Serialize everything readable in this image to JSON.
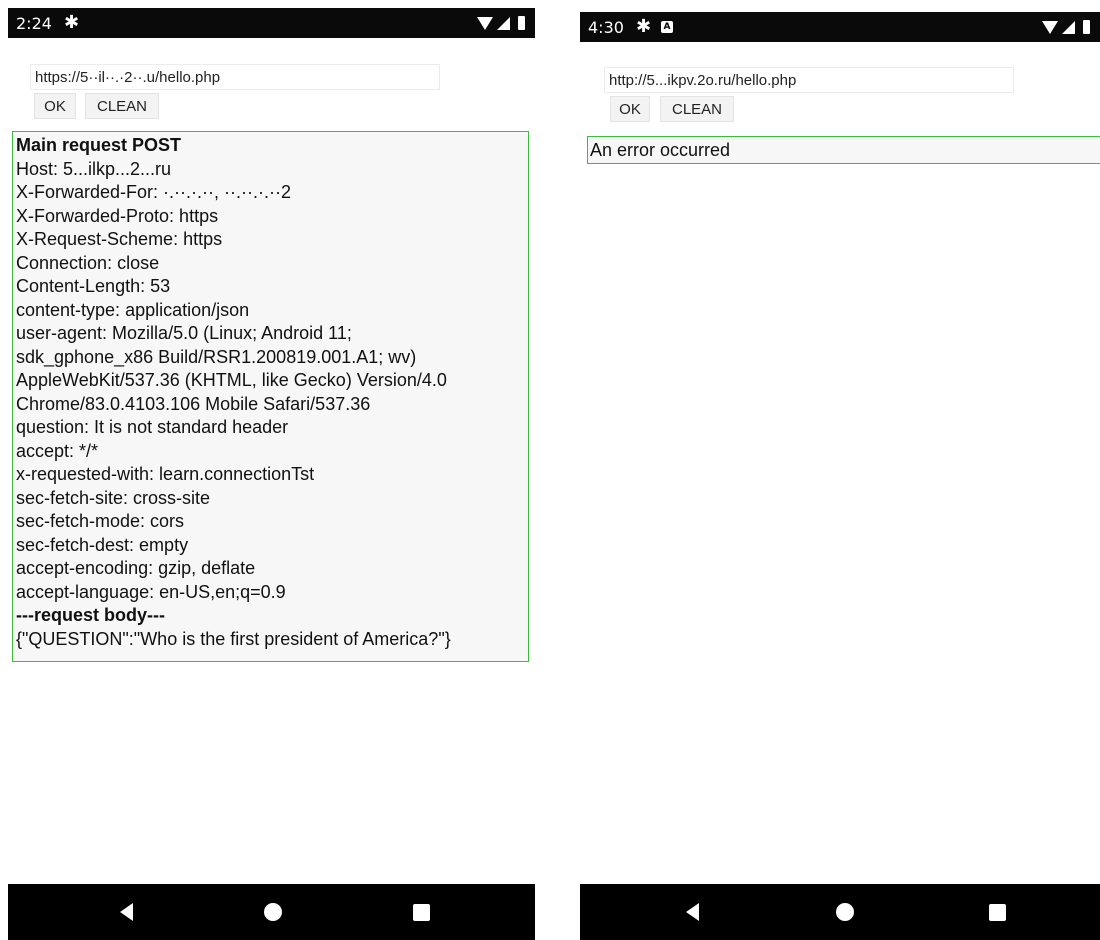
{
  "left": {
    "status": {
      "time": "2:24",
      "gear_icon": "gear-icon",
      "wifi_icon": "wifi-icon",
      "cell_icon": "cell-signal-icon",
      "battery_icon": "battery-icon"
    },
    "url": {
      "value": "https://5··il··.·2··.u/hello.php"
    },
    "buttons": {
      "ok": "OK",
      "clean": "CLEAN"
    },
    "response": {
      "title": "Main request POST",
      "lines": [
        "Host: 5...ilkp...2...ru",
        "X-Forwarded-For: ·.··.·.··, ··.··.·.··2",
        "X-Forwarded-Proto: https",
        "X-Request-Scheme: https",
        "Connection: close",
        "Content-Length: 53",
        "content-type: application/json",
        "user-agent: Mozilla/5.0 (Linux; Android 11;",
        "sdk_gphone_x86 Build/RSR1.200819.001.A1; wv)",
        "AppleWebKit/537.36 (KHTML, like Gecko) Version/4.0",
        "Chrome/83.0.4103.106 Mobile Safari/537.36",
        "question: It is not standard header",
        "accept: */*",
        "x-requested-with: learn.connectionTst",
        "sec-fetch-site: cross-site",
        "sec-fetch-mode: cors",
        "sec-fetch-dest: empty",
        "accept-encoding: gzip, deflate",
        "accept-language: en-US,en;q=0.9"
      ],
      "body_header": "---request body---",
      "body": "{\"QUESTION\":\"Who is the first president of America?\"}"
    },
    "nav": {
      "back_icon": "back-icon",
      "home_icon": "home-icon",
      "recents_icon": "recents-icon"
    }
  },
  "right": {
    "status": {
      "time": "4:30",
      "gear_icon": "gear-icon",
      "a_icon": "A",
      "wifi_icon": "wifi-icon",
      "cell_icon": "cell-signal-icon",
      "battery_icon": "battery-icon"
    },
    "url": {
      "value": "http://5...ikpv.2o.ru/hello.php"
    },
    "buttons": {
      "ok": "OK",
      "clean": "CLEAN"
    },
    "error": "An error occurred",
    "nav": {
      "back_icon": "back-icon",
      "home_icon": "home-icon",
      "recents_icon": "recents-icon"
    }
  }
}
